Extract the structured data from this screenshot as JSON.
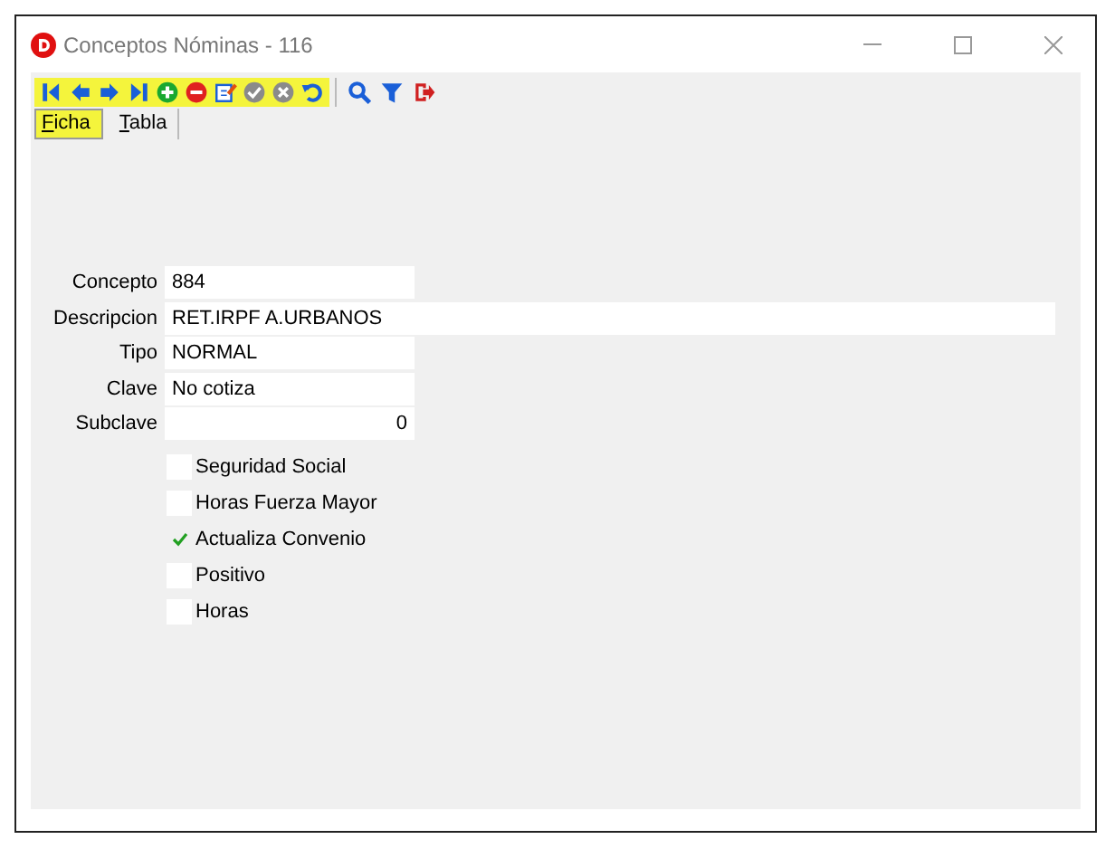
{
  "window": {
    "title": "Conceptos Nóminas -   116"
  },
  "toolbar": [
    {
      "kind": "first"
    },
    {
      "kind": "prev"
    },
    {
      "kind": "next"
    },
    {
      "kind": "last"
    },
    {
      "kind": "add"
    },
    {
      "kind": "delete"
    },
    {
      "kind": "edit"
    },
    {
      "kind": "confirm"
    },
    {
      "kind": "cancel"
    },
    {
      "kind": "undo"
    },
    {
      "kind": "separator"
    },
    {
      "kind": "search"
    },
    {
      "kind": "filter"
    },
    {
      "kind": "exit"
    }
  ],
  "tabs": [
    {
      "label": "Ficha",
      "selected": true
    },
    {
      "label": "Tabla",
      "selected": false
    }
  ],
  "fields": [
    {
      "label": "Concepto",
      "value": "884",
      "kind": "short"
    },
    {
      "label": "Descripcion",
      "value": "RET.IRPF A.URBANOS",
      "kind": "wide"
    },
    {
      "label": "Tipo",
      "value": "NORMAL",
      "kind": "short"
    },
    {
      "label": "Clave",
      "value": "No cotiza",
      "kind": "short"
    },
    {
      "label": "Subclave",
      "value": "0",
      "kind": "number"
    }
  ],
  "checkboxes": [
    {
      "label": "Seguridad Social",
      "checked": false
    },
    {
      "label": "Horas Fuerza Mayor",
      "checked": false
    },
    {
      "label": "Actualiza Convenio",
      "checked": true
    },
    {
      "label": "Positivo",
      "checked": false
    },
    {
      "label": "Horas",
      "checked": false
    }
  ]
}
